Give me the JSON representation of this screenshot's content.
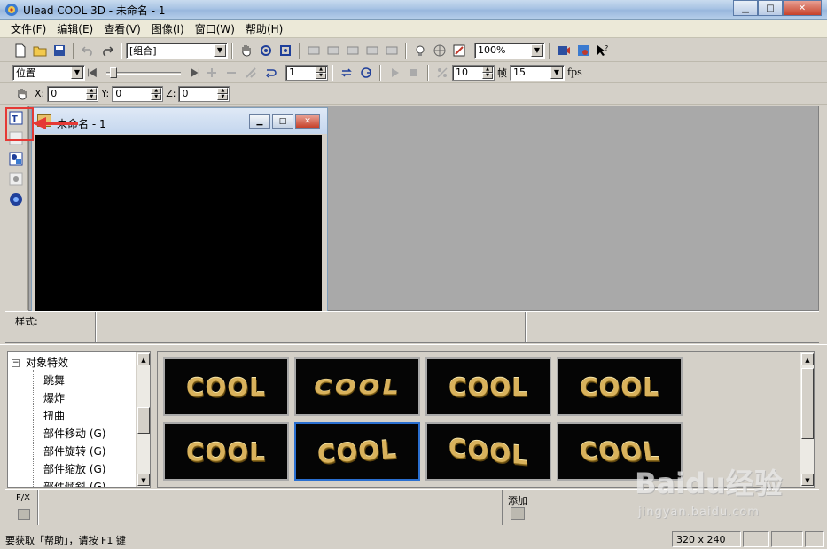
{
  "window": {
    "title": "Ulead COOL 3D - 未命名 - 1"
  },
  "menu": [
    "文件(F)",
    "编辑(E)",
    "查看(V)",
    "图像(I)",
    "窗口(W)",
    "帮助(H)"
  ],
  "toolbar1": {
    "object_select": "[组合]",
    "zoom": "100%"
  },
  "toolbar2": {
    "mode": "位置",
    "frame_value": "1",
    "frames": "10",
    "frames_label": "帧",
    "fps_value": "15",
    "fps_label": "fps"
  },
  "toolbar3": {
    "x_label": "X:",
    "x_value": "0",
    "y_label": "Y:",
    "y_value": "0",
    "z_label": "Z:",
    "z_value": "0"
  },
  "document": {
    "title": "未命名 - 1"
  },
  "style_panel": {
    "label": "样式:"
  },
  "tree": {
    "root": "对象特效",
    "items": [
      "跳舞",
      "爆炸",
      "扭曲",
      "部件移动 (G)",
      "部件旋转 (G)",
      "部件缩放 (G)",
      "部件倾斜 (G)"
    ]
  },
  "gallery": {
    "items": [
      "COOL",
      "COOL",
      "COOL",
      "COOL",
      "COOL",
      "COOL",
      "COOL",
      "COOL"
    ],
    "selected_index": 5
  },
  "fx_bar": {
    "fx_label": "F/X",
    "add_label": "添加"
  },
  "status": {
    "message": "要获取「帮助」，请按 F1 键",
    "size": "320 x 240"
  },
  "watermark": {
    "brand": "Baidu经验",
    "url": "jingyan.baidu.com"
  },
  "colors": {
    "highlight": "#e53935",
    "selection": "#2a6fd0",
    "gold_text": "#d9b25c"
  }
}
